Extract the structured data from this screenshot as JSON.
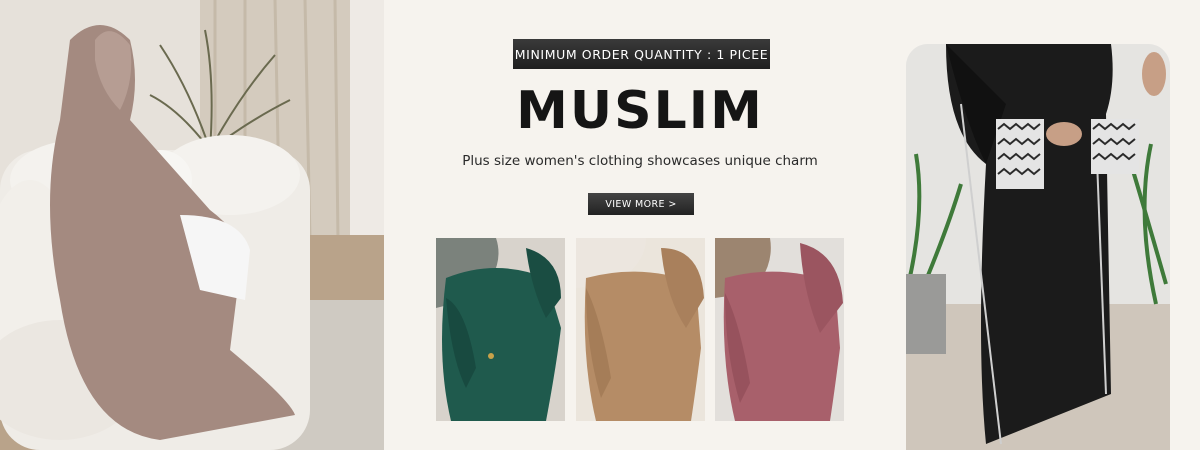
{
  "banner": {
    "badge_text": "MINIMUM ORDER QUANTITY : 1 PICEE",
    "title": "MUSLIM",
    "subtitle": "Plus size women's clothing showcases unique charm",
    "cta_label": "VIEW MORE >"
  },
  "colors": {
    "background": "#f6f3ee",
    "badge_bg": "#2a2a2a",
    "title_text": "#151515",
    "thumb_green": "#1f5a4d",
    "thumb_beige": "#b58c66",
    "thumb_rose": "#a8606b",
    "abaya_taupe": "#a48a80",
    "abaya_black": "#1b1b1b"
  },
  "products": [
    {
      "name": "green-abaya",
      "color": "#1f5a4d"
    },
    {
      "name": "beige-abaya",
      "color": "#b58c66"
    },
    {
      "name": "rose-abaya",
      "color": "#a8606b"
    }
  ]
}
